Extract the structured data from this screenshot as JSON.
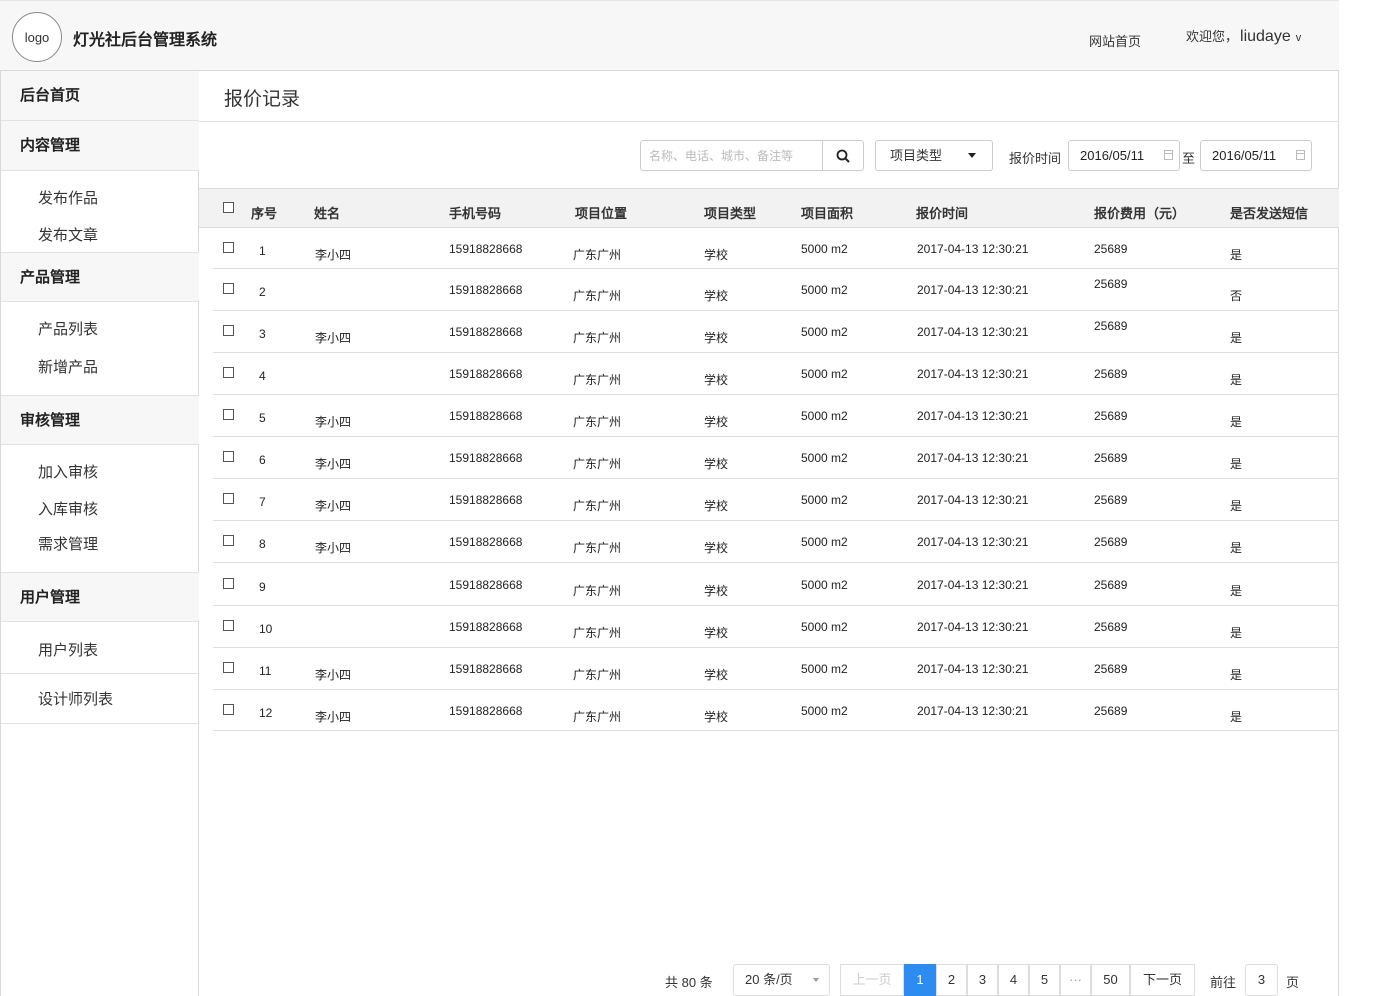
{
  "header": {
    "logo": "logo",
    "title": "灯光社后台管理系统",
    "home_link": "网站首页",
    "welcome": "欢迎您，",
    "user": "liudaye",
    "caret": "v"
  },
  "sidebar": {
    "home": "后台首页",
    "content": {
      "title": "内容管理",
      "items": [
        "发布作品",
        "发布文章"
      ]
    },
    "product": {
      "title": "产品管理",
      "items": [
        "产品列表",
        "新增产品"
      ]
    },
    "audit": {
      "title": "审核管理",
      "items": [
        "加入审核",
        "入库审核",
        "需求管理"
      ]
    },
    "user": {
      "title": "用户管理",
      "items": [
        "用户列表",
        "设计师列表"
      ]
    }
  },
  "main": {
    "title": "报价记录"
  },
  "filters": {
    "search_placeholder": "名称、电话、城市、备注等",
    "type_select": "项目类型",
    "time_label": "报价时间",
    "date_from": "2016/05/11",
    "to": "至",
    "date_to": "2016/05/11"
  },
  "table": {
    "headers": [
      "序号",
      "姓名",
      "手机号码",
      "项目位置",
      "项目类型",
      "项目面积",
      "报价时间",
      "报价费用（元）",
      "是否发送短信"
    ],
    "rows": [
      {
        "no": "1",
        "name": "李小四",
        "phone": "15918828668",
        "location": "广东广州",
        "type": "学校",
        "area": "5000 m2",
        "time": "2017-04-13 12:30:21",
        "cost": "25689",
        "sms": "是"
      },
      {
        "no": "2",
        "name": "",
        "phone": "15918828668",
        "location": "广东广州",
        "type": "学校",
        "area": "5000 m2",
        "time": "2017-04-13 12:30:21",
        "cost": "25689",
        "sms": "否"
      },
      {
        "no": "3",
        "name": "李小四",
        "phone": "15918828668",
        "location": "广东广州",
        "type": "学校",
        "area": "5000 m2",
        "time": "2017-04-13 12:30:21",
        "cost": "25689",
        "sms": "是"
      },
      {
        "no": "4",
        "name": "",
        "phone": "15918828668",
        "location": "广东广州",
        "type": "学校",
        "area": "5000 m2",
        "time": "2017-04-13 12:30:21",
        "cost": "25689",
        "sms": "是"
      },
      {
        "no": "5",
        "name": "李小四",
        "phone": "15918828668",
        "location": "广东广州",
        "type": "学校",
        "area": "5000 m2",
        "time": "2017-04-13 12:30:21",
        "cost": "25689",
        "sms": "是"
      },
      {
        "no": "6",
        "name": "李小四",
        "phone": "15918828668",
        "location": "广东广州",
        "type": "学校",
        "area": "5000 m2",
        "time": "2017-04-13 12:30:21",
        "cost": "25689",
        "sms": "是"
      },
      {
        "no": "7",
        "name": "李小四",
        "phone": "15918828668",
        "location": "广东广州",
        "type": "学校",
        "area": "5000 m2",
        "time": "2017-04-13 12:30:21",
        "cost": "25689",
        "sms": "是"
      },
      {
        "no": "8",
        "name": "李小四",
        "phone": "15918828668",
        "location": "广东广州",
        "type": "学校",
        "area": "5000 m2",
        "time": "2017-04-13 12:30:21",
        "cost": "25689",
        "sms": "是"
      },
      {
        "no": "9",
        "name": "",
        "phone": "15918828668",
        "location": "广东广州",
        "type": "学校",
        "area": "5000 m2",
        "time": "2017-04-13 12:30:21",
        "cost": "25689",
        "sms": "是"
      },
      {
        "no": "10",
        "name": "",
        "phone": "15918828668",
        "location": "广东广州",
        "type": "学校",
        "area": "5000 m2",
        "time": "2017-04-13 12:30:21",
        "cost": "25689",
        "sms": "是"
      },
      {
        "no": "11",
        "name": "李小四",
        "phone": "15918828668",
        "location": "广东广州",
        "type": "学校",
        "area": "5000 m2",
        "time": "2017-04-13 12:30:21",
        "cost": "25689",
        "sms": "是"
      },
      {
        "no": "12",
        "name": "李小四",
        "phone": "15918828668",
        "location": "广东广州",
        "type": "学校",
        "area": "5000 m2",
        "time": "2017-04-13 12:30:21",
        "cost": "25689",
        "sms": "是"
      }
    ]
  },
  "pagination": {
    "total": "共 80 条",
    "page_size": "20 条/页",
    "prev": "上一页",
    "pages": [
      "1",
      "2",
      "3",
      "4",
      "5"
    ],
    "ellipsis": "···",
    "last": "50",
    "next": "下一页",
    "goto_label": "前往",
    "goto_value": "3",
    "page_suffix": "页",
    "active_color": "#2d8cf0"
  },
  "icons": {
    "search": "search-icon",
    "calendar": "calendar-icon",
    "dropdown": "caret-down-icon"
  }
}
